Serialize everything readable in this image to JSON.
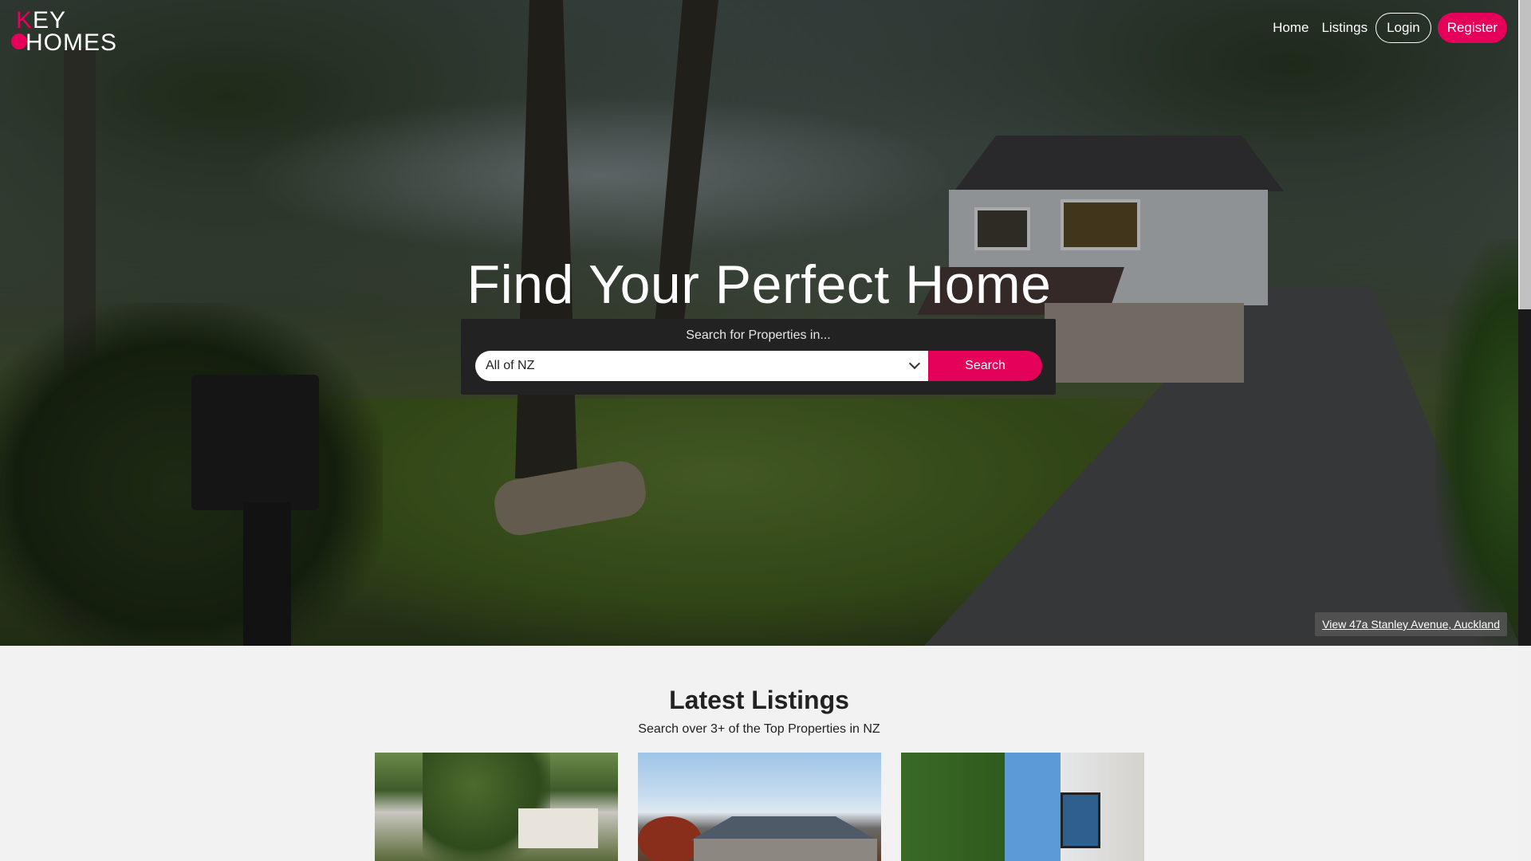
{
  "brand": {
    "logo_top": "EY",
    "logo_k": "K",
    "logo_bottom": "HOMES"
  },
  "nav": {
    "home": "Home",
    "listings": "Listings",
    "login": "Login",
    "register": "Register"
  },
  "hero": {
    "title": "Find Your Perfect Home",
    "search_label": "Search for Properties in...",
    "select_value": "All of NZ",
    "search_button": "Search",
    "view_caption": "View 47a Stanley Avenue, Auckland"
  },
  "latest": {
    "title": "Latest Listings",
    "subtitle": "Search over 3+ of the Top Properties in NZ"
  },
  "colors": {
    "accent": "#e5005a"
  }
}
